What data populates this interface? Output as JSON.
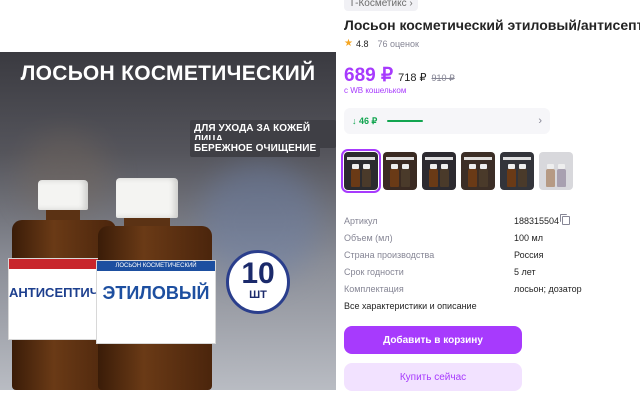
{
  "product": {
    "brand": "Т-Косметикс",
    "title": "Лосьон косметический этиловый/антисептический",
    "rating": "4.8",
    "reviews": "76 оценок"
  },
  "photo": {
    "headline": "ЛОСЬОН КОСМЕТИЧЕСКИЙ",
    "tag1": "ДЛЯ УХОДА ЗА КОЖЕЙ ЛИЦА",
    "tag2": "БЕРЕЖНОЕ ОЧИЩЕНИЕ",
    "badge_number": "10",
    "badge_unit": "ШТ",
    "bottle_left_label": "АНТИСЕПТИЧЕСКИЙ",
    "bottle_right_top": "ЛОСЬОН КОСМЕТИЧЕСКИЙ",
    "bottle_right_label": "ЭТИЛОВЫЙ"
  },
  "price": {
    "current": "689 ₽",
    "wb_price": "718 ₽",
    "old": "910 ₽",
    "wallet_note": "с WB кошельком",
    "cashback": "↓ 46 ₽"
  },
  "specs": [
    {
      "key": "Артикул",
      "value": "188315504"
    },
    {
      "key": "Объем (мл)",
      "value": "100 мл"
    },
    {
      "key": "Страна производства",
      "value": "Россия"
    },
    {
      "key": "Срок годности",
      "value": "5 лет"
    },
    {
      "key": "Комплектация",
      "value": "лосьон; дозатор"
    }
  ],
  "all_specs_link": "Все характеристики и описание",
  "buttons": {
    "add_to_cart": "Добавить в корзину",
    "buy_now": "Купить сейчас"
  },
  "colors": {
    "accent": "#a73afd",
    "accent_light": "#f2e2ff",
    "cashback_green": "#12a550"
  }
}
